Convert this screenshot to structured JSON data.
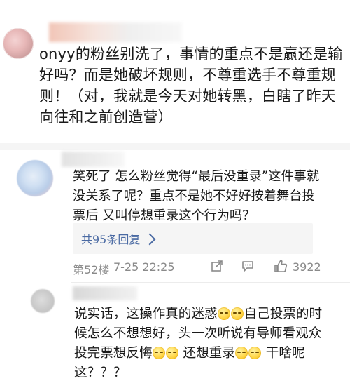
{
  "comment1": {
    "text": "onyy的粉丝别洗了，事情的重点不是赢还是输好吗？而是她破坏规则，不尊重选手不尊重规则！（对，我就是今天对她转黑，白瞎了昨天向往和之前创造营）"
  },
  "comment2": {
    "text": "笑死了 怎么粉丝觉得“最后没重录”这件事就没关系了呢？重点不是她不好好按着舞台投票后 又叫停想重录这个行为吗？",
    "replies_label": "共95条回复",
    "floor": "第52楼",
    "timestamp": "7-25 22:25",
    "likes": "3922"
  },
  "comment3": {
    "part1": "说实话，这操作真的迷惑",
    "part2": "自己投票的时候怎么不想想好，头一次听说有导师看观众投完票想反悔",
    "part3": " 还想重录",
    "part4": " 干啥呢这？？？"
  },
  "icons": {
    "share": "share-icon",
    "comment": "comment-icon",
    "like": "thumbs-up-icon",
    "reply_chevron": "chevron-right-icon",
    "emoji": "emoji-face-icon"
  },
  "colors": {
    "link": "#4a6aa3",
    "meta": "#8a8a8a",
    "divider": "#f5f5f5"
  }
}
